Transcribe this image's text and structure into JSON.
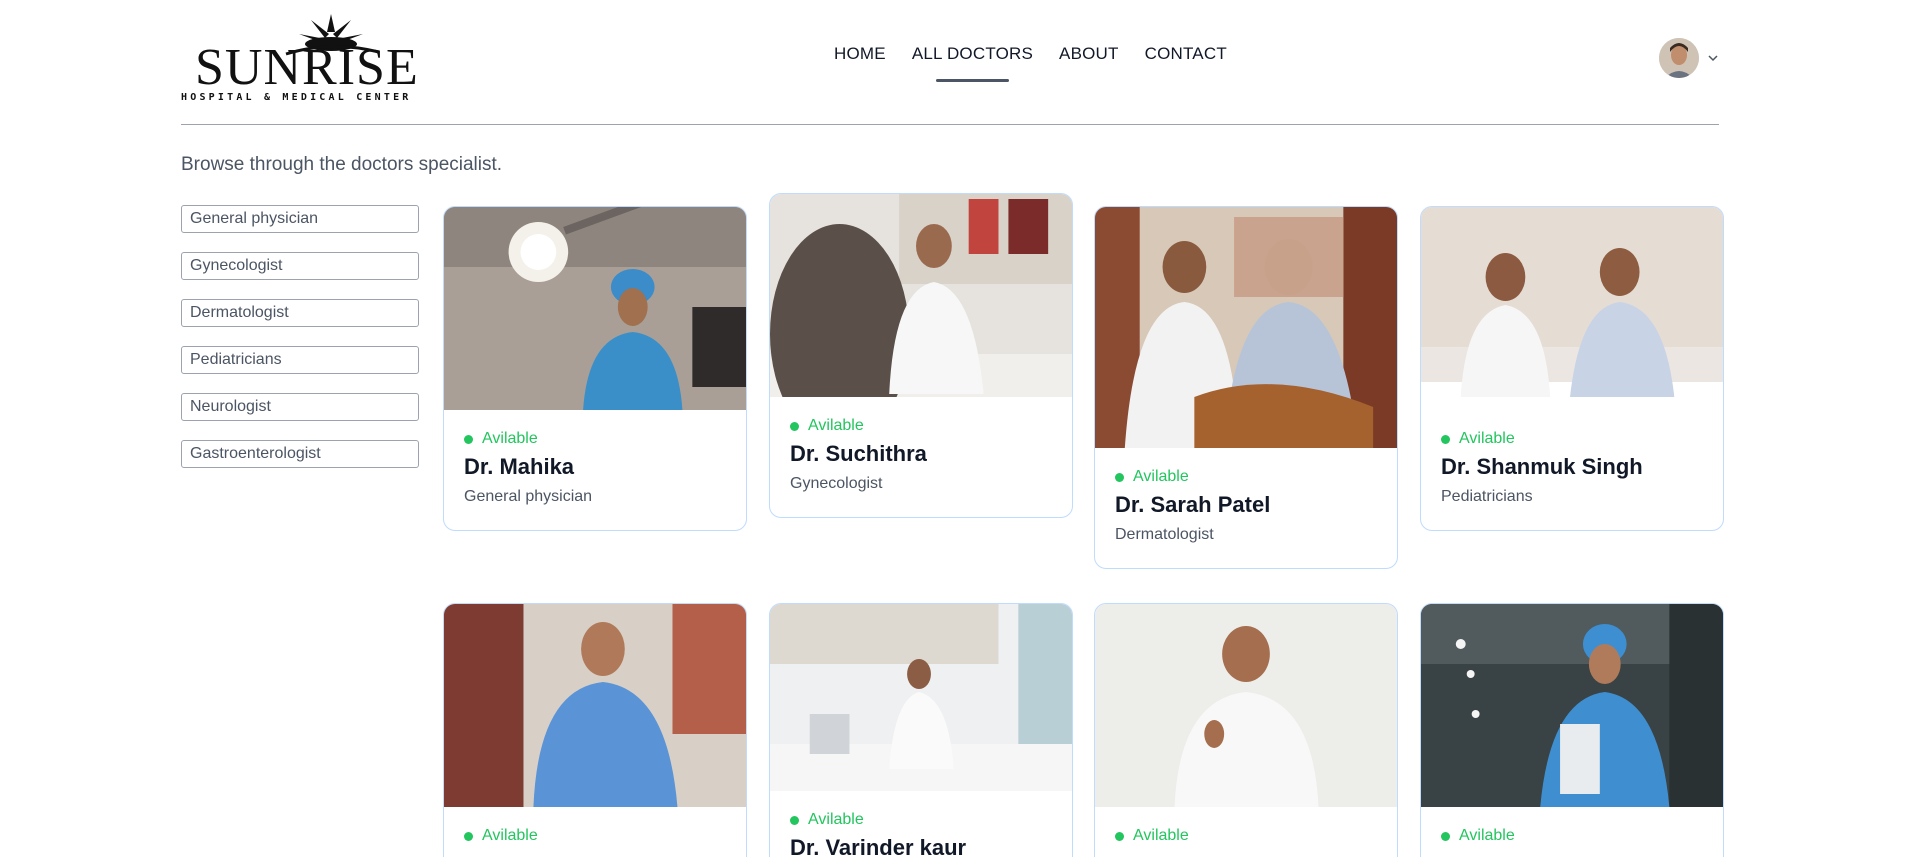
{
  "logo": {
    "word": "SUNRISE",
    "subtitle": "HOSPITAL & MEDICAL CENTER"
  },
  "nav": [
    {
      "label": "HOME",
      "active": false
    },
    {
      "label": "ALL DOCTORS",
      "active": true
    },
    {
      "label": "ABOUT",
      "active": false
    },
    {
      "label": "CONTACT",
      "active": false
    }
  ],
  "intro": "Browse through the doctors specialist.",
  "filters": [
    "General physician",
    "Gynecologist",
    "Dermatologist",
    "Pediatricians",
    "Neurologist",
    "Gastroenterologist"
  ],
  "doctors": [
    {
      "status": "Avilable",
      "name": "Dr. Mahika",
      "speciality": "General physician",
      "icon": "doctor-photo"
    },
    {
      "status": "Avilable",
      "name": "Dr. Suchithra",
      "speciality": "Gynecologist",
      "icon": "doctor-photo"
    },
    {
      "status": "Avilable",
      "name": "Dr. Sarah Patel",
      "speciality": "Dermatologist",
      "icon": "doctor-photo"
    },
    {
      "status": "Avilable",
      "name": "Dr. Shanmuk Singh",
      "speciality": "Pediatricians",
      "icon": "doctor-photo"
    },
    {
      "status": "Avilable",
      "name": "",
      "speciality": "",
      "icon": "doctor-photo"
    },
    {
      "status": "Avilable",
      "name": "Dr. Varinder kaur",
      "speciality": "",
      "icon": "doctor-photo"
    },
    {
      "status": "Avilable",
      "name": "",
      "speciality": "",
      "icon": "doctor-photo"
    },
    {
      "status": "Avilable",
      "name": "",
      "speciality": "",
      "icon": "doctor-photo"
    }
  ],
  "colors": {
    "accent_green": "#22c55e",
    "card_border": "#bfdbfe",
    "nav_underline": "#4b5563"
  }
}
